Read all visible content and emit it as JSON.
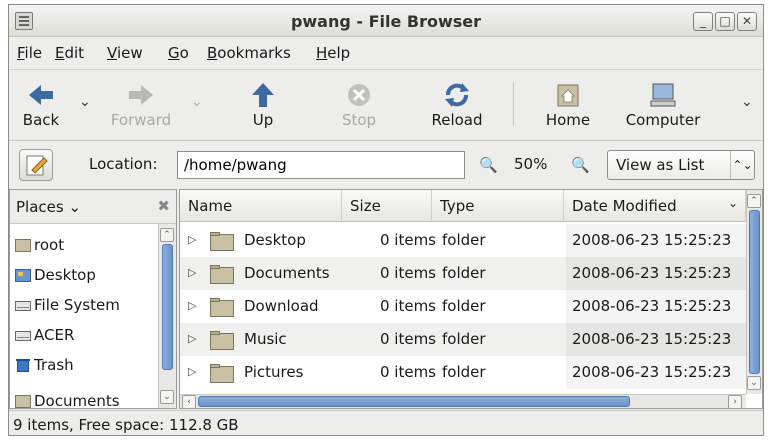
{
  "window": {
    "title": "pwang - File Browser"
  },
  "menu": [
    "File",
    "Edit",
    "View",
    "Go",
    "Bookmarks",
    "Help"
  ],
  "toolbar": {
    "back": "Back",
    "forward": "Forward",
    "up": "Up",
    "stop": "Stop",
    "reload": "Reload",
    "home": "Home",
    "computer": "Computer"
  },
  "location": {
    "label": "Location:",
    "value": "/home/pwang",
    "zoom": "50%",
    "view_mode": "View as List"
  },
  "sidebar": {
    "header": "Places",
    "items": [
      {
        "label": "root",
        "icon": "home-folder-icon"
      },
      {
        "label": "Desktop",
        "icon": "desktop-icon"
      },
      {
        "label": "File System",
        "icon": "drive-icon"
      },
      {
        "label": "ACER",
        "icon": "drive-icon"
      },
      {
        "label": "Trash",
        "icon": "trash-icon"
      },
      {
        "label": "Documents",
        "icon": "folder-icon"
      }
    ]
  },
  "files": {
    "columns": [
      "Name",
      "Size",
      "Type",
      "Date Modified"
    ],
    "rows": [
      {
        "name": "Desktop",
        "size": "0 items",
        "type": "folder",
        "date": "2008-06-23 15:25:23"
      },
      {
        "name": "Documents",
        "size": "0 items",
        "type": "folder",
        "date": "2008-06-23 15:25:23"
      },
      {
        "name": "Download",
        "size": "0 items",
        "type": "folder",
        "date": "2008-06-23 15:25:23"
      },
      {
        "name": "Music",
        "size": "0 items",
        "type": "folder",
        "date": "2008-06-23 15:25:23"
      },
      {
        "name": "Pictures",
        "size": "0 items",
        "type": "folder",
        "date": "2008-06-23 15:25:23"
      }
    ]
  },
  "status": {
    "text": "9 items, Free space: 112.8 GB"
  },
  "colors": {
    "accent": "#3d6aa0",
    "folder": "#c9c1a3",
    "scrollbar": "#6a92cc"
  }
}
